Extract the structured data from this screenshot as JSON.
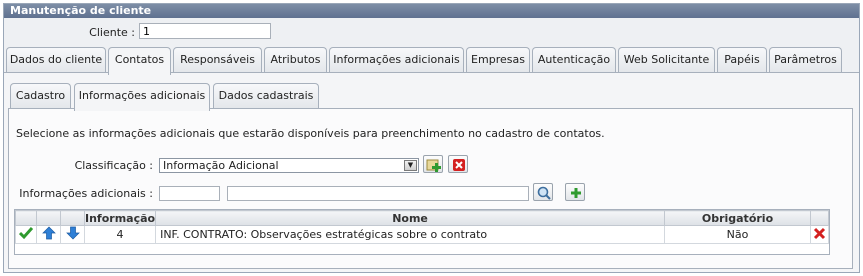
{
  "panel": {
    "title": "Manutenção de cliente"
  },
  "client": {
    "label": "Cliente :",
    "value": "1"
  },
  "main_tabs": [
    {
      "label": "Dados do cliente"
    },
    {
      "label": "Contatos"
    },
    {
      "label": "Responsáveis"
    },
    {
      "label": "Atributos"
    },
    {
      "label": "Informações adicionais"
    },
    {
      "label": "Empresas"
    },
    {
      "label": "Autenticação"
    },
    {
      "label": "Web Solicitante"
    },
    {
      "label": "Papéis"
    },
    {
      "label": "Parâmetros"
    }
  ],
  "main_active_tab": "Contatos",
  "sub_tabs": [
    {
      "label": "Cadastro"
    },
    {
      "label": "Informações adicionais"
    },
    {
      "label": "Dados cadastrais"
    }
  ],
  "sub_active_tab": "Informações adicionais",
  "description": "Selecione as informações adicionais que estarão disponíveis para preenchimento no cadastro de contatos.",
  "form": {
    "classificacao_label": "Classificação :",
    "classificacao_value": "Informação Adicional",
    "info_label": "Informações adicionais :",
    "info_code_value": "",
    "info_desc_value": ""
  },
  "grid": {
    "columns": [
      "Informação",
      "Nome",
      "Obrigatório"
    ],
    "rows": [
      {
        "informacao": "4",
        "nome": "INF. CONTRATO: Observações estratégicas sobre o contrato",
        "obrigatorio": "Não"
      }
    ]
  },
  "icons": {
    "add_classificacao": "add-icon",
    "remove_classificacao": "delete-icon",
    "search": "search-icon",
    "add_info": "add-icon",
    "row_confirm": "check-icon",
    "row_up": "arrow-up-icon",
    "row_down": "arrow-down-icon",
    "row_delete": "delete-icon"
  },
  "colors": {
    "header": "#6b7c97",
    "accent_green": "#2f9a2f",
    "delete_red": "#d42020",
    "arrow_blue": "#2e7fd6"
  }
}
